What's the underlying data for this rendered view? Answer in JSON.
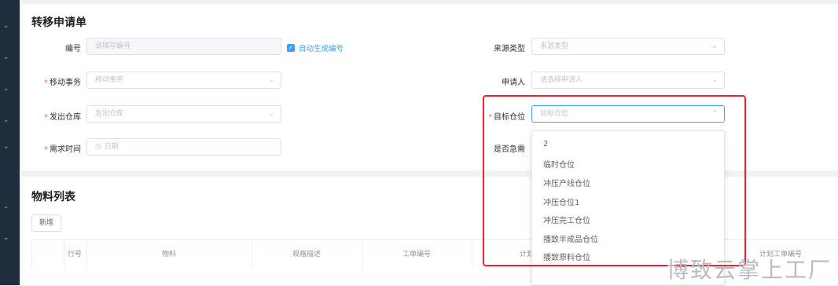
{
  "form": {
    "title": "转移申请单",
    "code": {
      "label": "编号",
      "placeholder": "请填写编号"
    },
    "auto_generate": {
      "label": "自动生成编号",
      "checked": true
    },
    "source_type": {
      "label": "来源类型",
      "placeholder": "来源类型"
    },
    "move_event": {
      "label": "移动事务",
      "placeholder": "移动事务",
      "required_mark": "*"
    },
    "applicant": {
      "label": "申请人",
      "placeholder": "请选择申请人"
    },
    "source_warehouse": {
      "label": "发出仓库",
      "placeholder": "发出仓库",
      "required_mark": "*"
    },
    "target_location": {
      "label": "目标仓位",
      "placeholder": "目标仓位",
      "required_mark": "*"
    },
    "required_time": {
      "label": "需求时间",
      "placeholder": "日期",
      "required_mark": "*"
    },
    "urgent": {
      "label": "是否急需"
    }
  },
  "dropdown": {
    "options": [
      "2",
      "临时仓位",
      "冲压产线仓位",
      "冲压仓位1",
      "冲压完工仓位",
      "播致半成品仓位",
      "播致原料仓位"
    ]
  },
  "materials": {
    "title": "物料列表",
    "new_button": "新增",
    "columns": [
      "行号",
      "物料",
      "规格描述",
      "工单编号",
      "计划",
      "计划工单编号"
    ]
  },
  "watermark": "博致云掌上工厂",
  "icons": {
    "arrow_down": "chevron-down-icon",
    "arrow_up": "chevron-up-icon",
    "check": "check-icon",
    "calendar": "clock-icon"
  },
  "colors": {
    "primary": "#409eff",
    "required": "#f56c6c",
    "highlight": "#f5222d"
  }
}
